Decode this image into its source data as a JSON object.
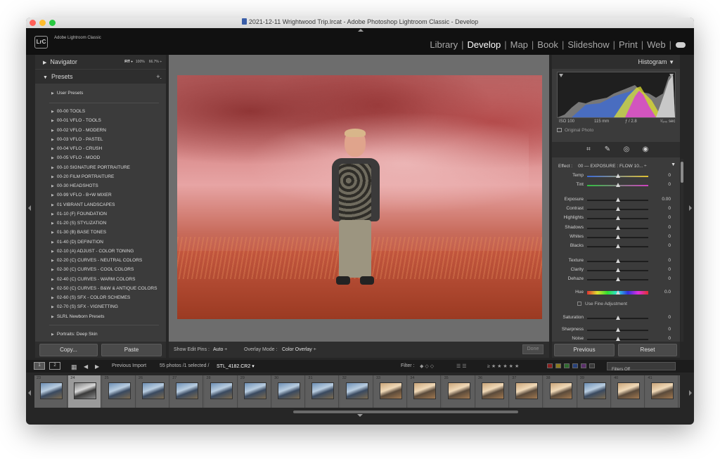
{
  "window": {
    "title": "2021-12-11 Wrightwood Trip.lrcat - Adobe Photoshop Lightroom Classic - Develop",
    "brand": "Adobe Lightroom Classic",
    "logo": "LrC"
  },
  "modules": [
    {
      "label": "Library",
      "active": false
    },
    {
      "label": "Develop",
      "active": true
    },
    {
      "label": "Map",
      "active": false
    },
    {
      "label": "Book",
      "active": false
    },
    {
      "label": "Slideshow",
      "active": false
    },
    {
      "label": "Print",
      "active": false
    },
    {
      "label": "Web",
      "active": false
    }
  ],
  "navigator": {
    "title": "Navigator",
    "fit": "FIT ÷",
    "zoom1": "100%",
    "zoom2": "66.7% ÷"
  },
  "presets": {
    "title": "Presets",
    "add": "+.",
    "user": "User Presets",
    "items": [
      "00-00 TOOLS",
      "00-01 VFLO - TOOLS",
      "00-02 VFLO - MODERN",
      "00-03 VFLO - PASTEL",
      "00-04 VFLO - CRUSH",
      "00-05 VFLO - MOOD",
      "00-10 SIGNATURE PORTRAITURE",
      "00-20 FILM PORTRAITURE",
      "00-30 HEADSHOTS",
      "00-99 VFLO - B+W MIXER",
      "01 VIBRANT LANDSCAPES",
      "01-10 (F) FOUNDATION",
      "01-20 (S) STYLIZATION",
      "01-30 (B) BASE TONES",
      "01-40 (D) DEFINITION",
      "02-10 (A) ADJUST - COLOR TONING",
      "02-20 (C) CURVES - NEUTRAL COLORS",
      "02-30 (C) CURVES - COOL COLORS",
      "02-40 (C) CURVES - WARM COLORS",
      "02-50 (C) CURVES - B&W & ANTIQUE COLORS",
      "02-60 (S) SFX - COLOR SCHEMES",
      "02-70 (S) SFX - VIGNETTING",
      "SLRL Newborn Presets"
    ],
    "last": "Portraits: Deep Skin"
  },
  "left_buttons": {
    "copy": "Copy...",
    "paste": "Paste"
  },
  "toolbar": {
    "pins_label": "Show Edit Pins :",
    "pins_value": "Auto ÷",
    "overlay_label": "Overlay Mode :",
    "overlay_value": "Color Overlay ÷",
    "done": "Done"
  },
  "histogram": {
    "title": "Histogram",
    "iso": "ISO 100",
    "focal": "115 mm",
    "aperture": "ƒ / 2.8",
    "shutter": "¹⁄₆₄₀ sec",
    "original": "Original Photo"
  },
  "effect": {
    "label": "Effect :",
    "value": "00 — EXPOSURE : FLOW 10... ÷"
  },
  "adjustments": [
    {
      "label": "Temp",
      "value": "0",
      "pos": 0.5,
      "track": "temp"
    },
    {
      "label": "Tint",
      "value": "0",
      "pos": 0.5,
      "track": "tint"
    },
    {
      "label": "Exposure",
      "value": "0.00",
      "pos": 0.5,
      "track": "plain"
    },
    {
      "label": "Contrast",
      "value": "0",
      "pos": 0.5,
      "track": "plain"
    },
    {
      "label": "Highlights",
      "value": "0",
      "pos": 0.5,
      "track": "plain"
    },
    {
      "label": "Shadows",
      "value": "0",
      "pos": 0.5,
      "track": "plain"
    },
    {
      "label": "Whites",
      "value": "0",
      "pos": 0.5,
      "track": "plain"
    },
    {
      "label": "Blacks",
      "value": "0",
      "pos": 0.5,
      "track": "plain"
    },
    {
      "label": "Texture",
      "value": "0",
      "pos": 0.5,
      "track": "plain"
    },
    {
      "label": "Clarity",
      "value": "0",
      "pos": 0.5,
      "track": "plain"
    },
    {
      "label": "Dehaze",
      "value": "0",
      "pos": 0.5,
      "track": "plain"
    },
    {
      "label": "Hue",
      "value": "0.0",
      "pos": 0.5,
      "track": "hue"
    },
    {
      "label": "Saturation",
      "value": "0",
      "pos": 0.5,
      "track": "plain"
    },
    {
      "label": "Sharpness",
      "value": "0",
      "pos": 0.5,
      "track": "plain"
    },
    {
      "label": "Noise",
      "value": "0",
      "pos": 0.5,
      "track": "plain"
    }
  ],
  "fine_adjust": "Use Fine Adjustment",
  "right_buttons": {
    "previous": "Previous",
    "reset": "Reset"
  },
  "filmbar": {
    "monitor1": "1",
    "monitor2": "2",
    "source": "Previous Import",
    "count": "55 photos /1 selected /",
    "filename": "STL_4182.CR2 ▾",
    "filter_label": "Filter :",
    "filters_off": "Filters Off"
  },
  "filmstrip": [
    {
      "num": "23",
      "tone": "cool"
    },
    {
      "num": "24",
      "tone": "gray",
      "selected": true
    },
    {
      "num": "25",
      "tone": "cool"
    },
    {
      "num": "26",
      "tone": "cool"
    },
    {
      "num": "27",
      "tone": "cool"
    },
    {
      "num": "28",
      "tone": "cool"
    },
    {
      "num": "29",
      "tone": "cool"
    },
    {
      "num": "30",
      "tone": "cool"
    },
    {
      "num": "31",
      "tone": "cool"
    },
    {
      "num": "32",
      "tone": "cool"
    },
    {
      "num": "33",
      "tone": "warm"
    },
    {
      "num": "34",
      "tone": "warm"
    },
    {
      "num": "35",
      "tone": "warm"
    },
    {
      "num": "36",
      "tone": "warm"
    },
    {
      "num": "37",
      "tone": "warm"
    },
    {
      "num": "38",
      "tone": "warm"
    },
    {
      "num": "39",
      "tone": "cool"
    },
    {
      "num": "40",
      "tone": "warm"
    },
    {
      "num": "41",
      "tone": "warm"
    }
  ],
  "colors": {
    "accent": "#ffffff",
    "panel": "#3b3b3b",
    "overlay": "#d05050"
  }
}
